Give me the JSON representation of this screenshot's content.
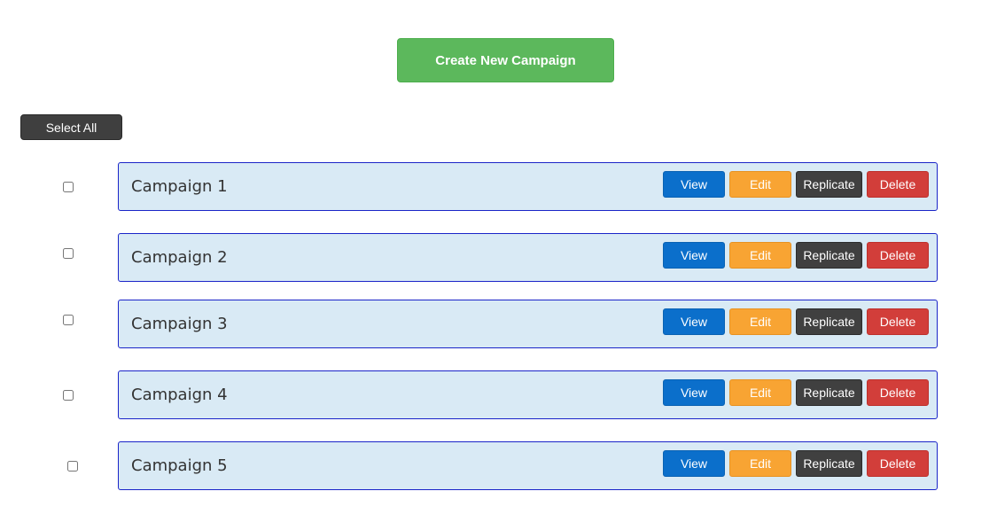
{
  "toolbar": {
    "create_label": "Create New Campaign",
    "select_all_label": "Select All"
  },
  "campaigns": [
    {
      "name": "Campaign 1",
      "checked": false
    },
    {
      "name": "Campaign 2",
      "checked": false
    },
    {
      "name": "Campaign 3",
      "checked": false
    },
    {
      "name": "Campaign 4",
      "checked": false
    },
    {
      "name": "Campaign 5",
      "checked": false
    }
  ],
  "actions": {
    "view_label": "View",
    "edit_label": "Edit",
    "replicate_label": "Replicate",
    "delete_label": "Delete"
  },
  "colors": {
    "create": "#5cb85c",
    "select_all": "#3f3f3f",
    "row_background": "#d9eaf5",
    "row_border": "#1a24c8",
    "view": "#0b6fcb",
    "edit": "#f8a433",
    "replicate": "#404040",
    "delete": "#d23e3a"
  }
}
